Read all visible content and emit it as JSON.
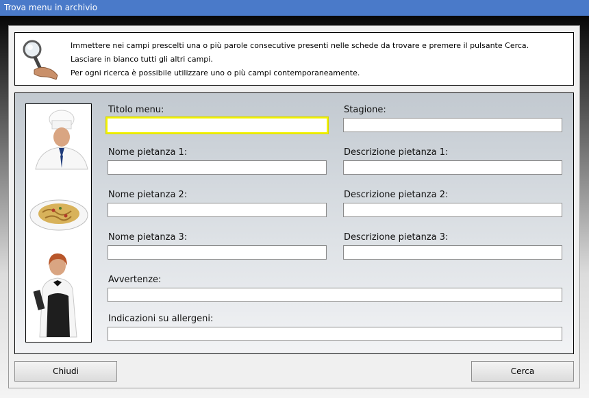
{
  "window": {
    "title": "Trova menu in archivio"
  },
  "info": {
    "lines": [
      "Immettere nei campi prescelti una o più parole consecutive presenti nelle schede da trovare e premere il pulsante Cerca.",
      "Lasciare in bianco tutti gli altri campi.",
      "Per ogni ricerca è possibile utilizzare uno o più campi contemporaneamente."
    ]
  },
  "form": {
    "titolo_menu": {
      "label": "Titolo menu:",
      "value": ""
    },
    "stagione": {
      "label": "Stagione:",
      "value": ""
    },
    "nome_pietanza_1": {
      "label": "Nome pietanza 1:",
      "value": ""
    },
    "descrizione_pietanza_1": {
      "label": "Descrizione pietanza 1:",
      "value": ""
    },
    "nome_pietanza_2": {
      "label": "Nome pietanza 2:",
      "value": ""
    },
    "descrizione_pietanza_2": {
      "label": "Descrizione pietanza 2:",
      "value": ""
    },
    "nome_pietanza_3": {
      "label": "Nome pietanza 3:",
      "value": ""
    },
    "descrizione_pietanza_3": {
      "label": "Descrizione pietanza 3:",
      "value": ""
    },
    "avvertenze": {
      "label": "Avvertenze:",
      "value": ""
    },
    "allergeni": {
      "label": "Indicazioni su allergeni:",
      "value": ""
    }
  },
  "buttons": {
    "close": "Chiudi",
    "search": "Cerca"
  },
  "colors": {
    "titlebar": "#4a7ac9",
    "focus_border": "#f2f200"
  }
}
